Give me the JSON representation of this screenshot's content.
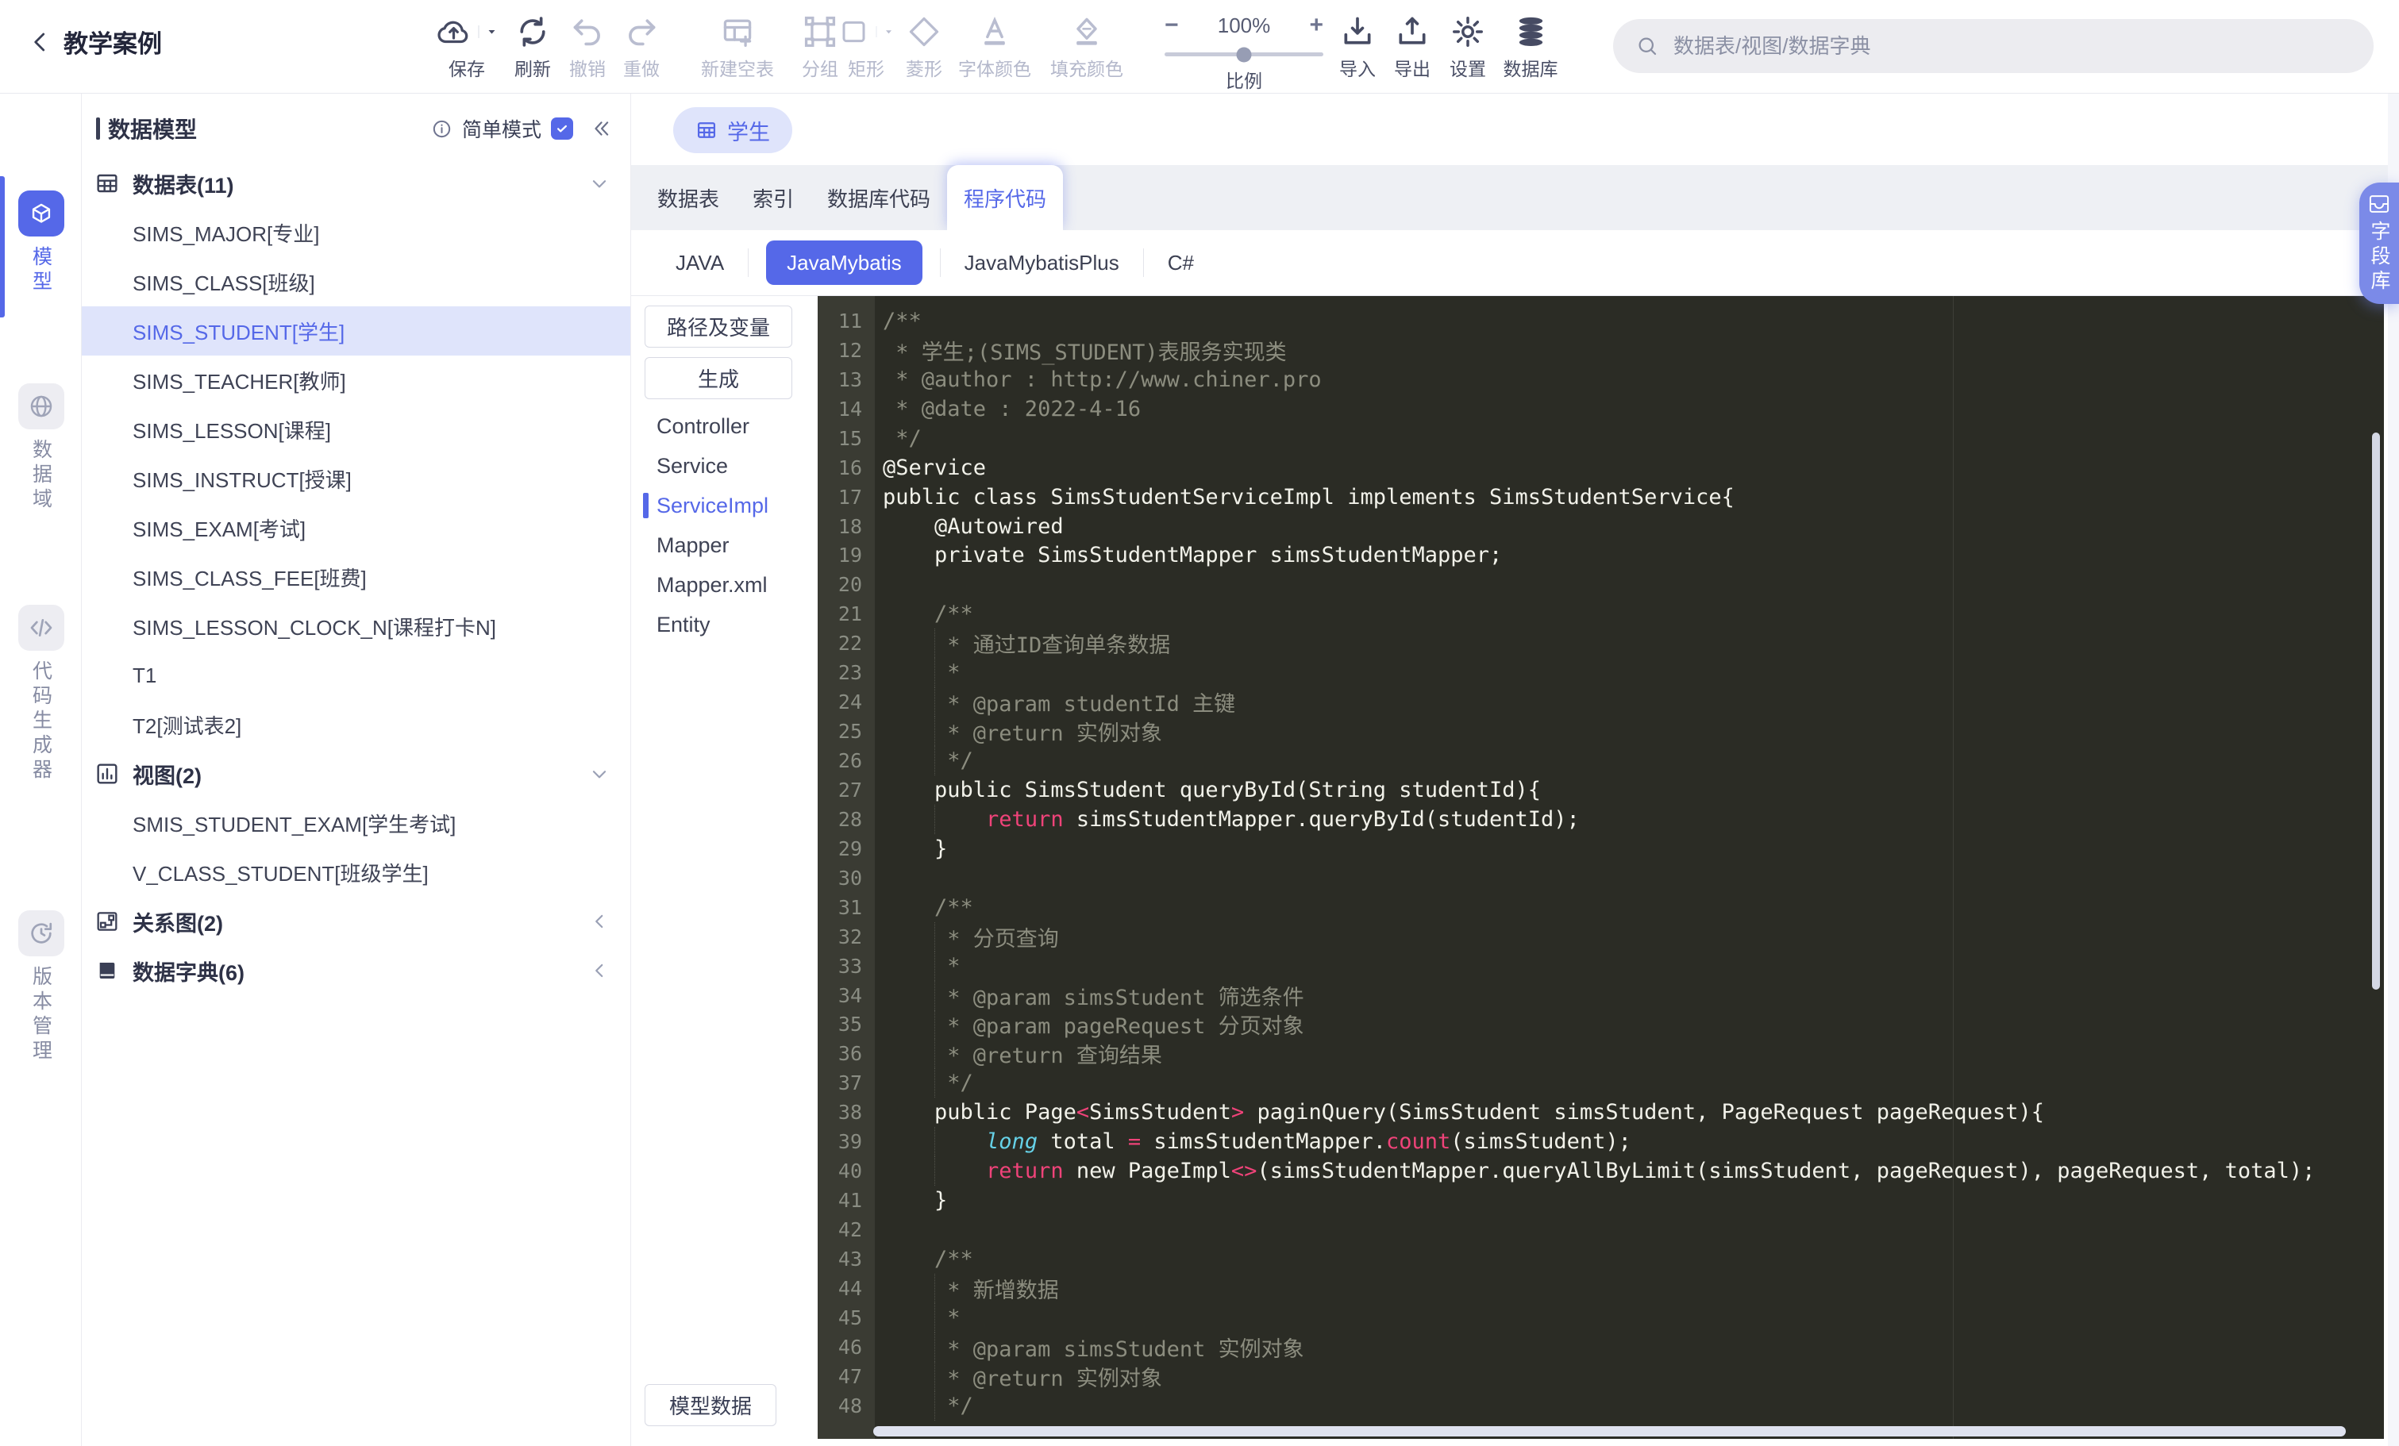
{
  "ui": {
    "accent": "#5568e8",
    "accent_light": "#dfe4fb"
  },
  "topbar": {
    "back_label": "教学案例",
    "tools": [
      {
        "label": "保存",
        "icon": "save-icon",
        "enabled": true,
        "caret": true
      },
      {
        "label": "刷新",
        "icon": "refresh-icon",
        "enabled": true
      },
      {
        "label": "撤销",
        "icon": "undo-icon",
        "enabled": false
      },
      {
        "label": "重做",
        "icon": "redo-icon",
        "enabled": false
      },
      {
        "label": "新建空表",
        "icon": "new-table-icon",
        "enabled": false
      },
      {
        "label": "分组",
        "icon": "group-icon",
        "enabled": false
      },
      {
        "label": "矩形",
        "icon": "rectangle-icon",
        "enabled": false,
        "caret": true
      },
      {
        "label": "菱形",
        "icon": "diamond-icon",
        "enabled": false
      },
      {
        "label": "字体颜色",
        "icon": "font-color-icon",
        "enabled": false
      },
      {
        "label": "填充颜色",
        "icon": "fill-color-icon",
        "enabled": false
      }
    ],
    "zoom": {
      "minus": "−",
      "value": "100%",
      "plus": "+",
      "label": "比例"
    },
    "right_tools": [
      {
        "label": "导入",
        "icon": "import-icon",
        "enabled": true
      },
      {
        "label": "导出",
        "icon": "export-icon",
        "enabled": true
      },
      {
        "label": "设置",
        "icon": "gear-icon",
        "enabled": true
      },
      {
        "label": "数据库",
        "icon": "database-icon",
        "enabled": true
      }
    ],
    "search": {
      "placeholder": "数据表/视图/数据字典"
    }
  },
  "rail": {
    "items": [
      {
        "label": "模型",
        "icon": "model-cube-icon",
        "active": true
      },
      {
        "label": "数据域",
        "icon": "globe-icon",
        "active": false
      },
      {
        "label": "代码生成器",
        "icon": "code-generator-icon",
        "active": false
      },
      {
        "label": "版本管理",
        "icon": "history-icon",
        "active": false
      }
    ]
  },
  "tree": {
    "title": "数据模型",
    "mode_label": "简单模式",
    "mode_checked": true,
    "sections": [
      {
        "label": "数据表(11)",
        "icon": "table-icon",
        "expanded": true,
        "items": [
          {
            "label": "SIMS_MAJOR[专业]"
          },
          {
            "label": "SIMS_CLASS[班级]"
          },
          {
            "label": "SIMS_STUDENT[学生]",
            "selected": true
          },
          {
            "label": "SIMS_TEACHER[教师]"
          },
          {
            "label": "SIMS_LESSON[课程]"
          },
          {
            "label": "SIMS_INSTRUCT[授课]"
          },
          {
            "label": "SIMS_EXAM[考试]"
          },
          {
            "label": "SIMS_CLASS_FEE[班费]"
          },
          {
            "label": "SIMS_LESSON_CLOCK_N[课程打卡N]"
          },
          {
            "label": "T1"
          },
          {
            "label": "T2[测试表2]"
          }
        ]
      },
      {
        "label": "视图(2)",
        "icon": "view-chart-icon",
        "expanded": true,
        "items": [
          {
            "label": "SMIS_STUDENT_EXAM[学生考试]"
          },
          {
            "label": "V_CLASS_STUDENT[班级学生]"
          }
        ]
      },
      {
        "label": "关系图(2)",
        "icon": "relation-diagram-icon",
        "expanded": false,
        "items": []
      },
      {
        "label": "数据字典(6)",
        "icon": "dictionary-book-icon",
        "expanded": false,
        "items": []
      }
    ]
  },
  "main": {
    "doc_tab": {
      "label": "学生",
      "icon": "table-icon"
    },
    "tabs": [
      {
        "label": "数据表"
      },
      {
        "label": "索引"
      },
      {
        "label": "数据库代码"
      },
      {
        "label": "程序代码",
        "active": true
      }
    ],
    "lang_tabs": [
      {
        "label": "JAVA"
      },
      {
        "label": "JavaMybatis",
        "active": true
      },
      {
        "label": "JavaMybatisPlus"
      },
      {
        "label": "C#"
      }
    ],
    "codenav": {
      "buttons": [
        "路径及变量",
        "生成"
      ],
      "items": [
        {
          "label": "Controller"
        },
        {
          "label": "Service"
        },
        {
          "label": "ServiceImpl",
          "selected": true
        },
        {
          "label": "Mapper"
        },
        {
          "label": "Mapper.xml"
        },
        {
          "label": "Entity"
        }
      ],
      "bottom_button": "模型数据"
    }
  },
  "editor": {
    "colors": {
      "bg": "#2b2c25",
      "gutter_bg": "#3a3b33",
      "line_no": "#8a8d83",
      "plain": "#f2f2ea",
      "comment": "#8c8d7f",
      "pink": "#ef4379",
      "cyan": "#66d2e8"
    },
    "lines": [
      {
        "n": 11,
        "segs": [
          [
            "comment",
            "/**"
          ]
        ]
      },
      {
        "n": 12,
        "segs": [
          [
            "comment",
            " * 学生;(SIMS_STUDENT)表服务实现类"
          ]
        ]
      },
      {
        "n": 13,
        "segs": [
          [
            "comment",
            " * @author : http://www.chiner.pro"
          ]
        ]
      },
      {
        "n": 14,
        "segs": [
          [
            "comment",
            " * @date : 2022-4-16"
          ]
        ]
      },
      {
        "n": 15,
        "segs": [
          [
            "comment",
            " */"
          ]
        ]
      },
      {
        "n": 16,
        "segs": [
          [
            "plain",
            "@Service"
          ]
        ]
      },
      {
        "n": 17,
        "segs": [
          [
            "plain",
            "public class SimsStudentServiceImpl implements SimsStudentService{"
          ]
        ]
      },
      {
        "n": 18,
        "segs": [
          [
            "plain",
            "    @Autowired"
          ]
        ]
      },
      {
        "n": 19,
        "segs": [
          [
            "plain",
            "    private SimsStudentMapper simsStudentMapper;"
          ]
        ]
      },
      {
        "n": 20,
        "segs": []
      },
      {
        "n": 21,
        "segs": [
          [
            "comment",
            "    /**"
          ]
        ]
      },
      {
        "n": 22,
        "segs": [
          [
            "comment",
            "     * 通过ID查询单条数据"
          ]
        ]
      },
      {
        "n": 23,
        "segs": [
          [
            "comment",
            "     *"
          ]
        ]
      },
      {
        "n": 24,
        "segs": [
          [
            "comment",
            "     * @param studentId 主键"
          ]
        ]
      },
      {
        "n": 25,
        "segs": [
          [
            "comment",
            "     * @return 实例对象"
          ]
        ]
      },
      {
        "n": 26,
        "segs": [
          [
            "comment",
            "     */"
          ]
        ]
      },
      {
        "n": 27,
        "segs": [
          [
            "plain",
            "    public SimsStudent queryById(String studentId){"
          ]
        ]
      },
      {
        "n": 28,
        "segs": [
          [
            "plain",
            "        "
          ],
          [
            "pink",
            "return"
          ],
          [
            "plain",
            " simsStudentMapper.queryById(studentId);"
          ]
        ]
      },
      {
        "n": 29,
        "segs": [
          [
            "plain",
            "    }"
          ]
        ]
      },
      {
        "n": 30,
        "segs": []
      },
      {
        "n": 31,
        "segs": [
          [
            "comment",
            "    /**"
          ]
        ]
      },
      {
        "n": 32,
        "segs": [
          [
            "comment",
            "     * 分页查询"
          ]
        ]
      },
      {
        "n": 33,
        "segs": [
          [
            "comment",
            "     *"
          ]
        ]
      },
      {
        "n": 34,
        "segs": [
          [
            "comment",
            "     * @param simsStudent 筛选条件"
          ]
        ]
      },
      {
        "n": 35,
        "segs": [
          [
            "comment",
            "     * @param pageRequest 分页对象"
          ]
        ]
      },
      {
        "n": 36,
        "segs": [
          [
            "comment",
            "     * @return 查询结果"
          ]
        ]
      },
      {
        "n": 37,
        "segs": [
          [
            "comment",
            "     */"
          ]
        ]
      },
      {
        "n": 38,
        "segs": [
          [
            "plain",
            "    public Page"
          ],
          [
            "pink",
            "<"
          ],
          [
            "plain",
            "SimsStudent"
          ],
          [
            "pink",
            ">"
          ],
          [
            "plain",
            " paginQuery(SimsStudent simsStudent, PageRequest pageRequest){"
          ]
        ]
      },
      {
        "n": 39,
        "segs": [
          [
            "plain",
            "        "
          ],
          [
            "cyan",
            "long"
          ],
          [
            "plain",
            " total "
          ],
          [
            "pink",
            "="
          ],
          [
            "plain",
            " simsStudentMapper."
          ],
          [
            "pink",
            "count"
          ],
          [
            "plain",
            "(simsStudent);"
          ]
        ]
      },
      {
        "n": 40,
        "segs": [
          [
            "plain",
            "        "
          ],
          [
            "pink",
            "return"
          ],
          [
            "plain",
            " new PageImpl"
          ],
          [
            "pink",
            "<>"
          ],
          [
            "plain",
            "(simsStudentMapper.queryAllByLimit(simsStudent, pageRequest), pageRequest, total);"
          ]
        ]
      },
      {
        "n": 41,
        "segs": [
          [
            "plain",
            "    }"
          ]
        ]
      },
      {
        "n": 42,
        "segs": []
      },
      {
        "n": 43,
        "segs": [
          [
            "comment",
            "    /**"
          ]
        ]
      },
      {
        "n": 44,
        "segs": [
          [
            "comment",
            "     * 新增数据"
          ]
        ]
      },
      {
        "n": 45,
        "segs": [
          [
            "comment",
            "     *"
          ]
        ]
      },
      {
        "n": 46,
        "segs": [
          [
            "comment",
            "     * @param simsStudent 实例对象"
          ]
        ]
      },
      {
        "n": 47,
        "segs": [
          [
            "comment",
            "     * @return 实例对象"
          ]
        ]
      },
      {
        "n": 48,
        "segs": [
          [
            "comment",
            "     */"
          ]
        ]
      }
    ]
  },
  "field_lib": {
    "label": "字段库",
    "icon": "tray-icon"
  }
}
